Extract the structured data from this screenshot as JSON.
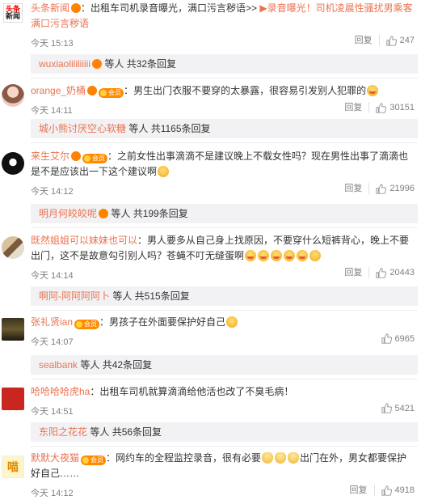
{
  "comments": [
    {
      "user": "头条新闻",
      "user_suffix": "：",
      "text": "出租车司机录音曝光，满口污言秽语>> ",
      "link": "录音曝光！司机凌晨性骚扰男乘客满口污言秽语",
      "time": "今天 15:13",
      "reply": "回复",
      "likes": "247"
    },
    {
      "user": "orange_奶桶",
      "user_suffix": "：",
      "text": "男生出门衣服不要穿的太暴露，很容易引发别人犯罪的",
      "time": "今天 14:11",
      "reply": "回复",
      "likes": "30151"
    },
    {
      "user": "来生艾尔",
      "user_suffix": "：",
      "text": "之前女性出事滴滴不是建议晚上不载女性吗？现在男性出事了滴滴也是不是应该出一下这个建议啊",
      "time": "今天 14:12",
      "reply": "回复",
      "likes": "21996"
    },
    {
      "user": "既然姐姐可以妹妹也可以",
      "user_suffix": "：",
      "text": "男人要多从自己身上找原因，不要穿什么短裤背心，晚上不要出门，这不是故意勾引别人吗？苍蝇不叮无缝蛋啊",
      "time": "今天 14:14",
      "reply": "回复",
      "likes": "20443"
    },
    {
      "user": "张礼贤ian",
      "user_suffix": "：",
      "text": "男孩子在外面要保护好自己",
      "time": "今天 14:07",
      "reply": "回复",
      "likes": "6965"
    },
    {
      "user": "哈哈哈哈虎ha",
      "user_suffix": "：",
      "text": "出租车司机就算滴滴给他活也改了不臭毛病！",
      "time": "今天 14:51",
      "reply": "回复",
      "likes": "5421"
    },
    {
      "user": "默默大夜猫",
      "user_suffix": "：",
      "text": "网约车的全程监控录音，很有必要",
      "text2": "出门在外，男女都要保护好自己……",
      "time": "今天 14:12",
      "reply": "回复",
      "likes": "4918"
    }
  ],
  "subreplies": [
    {
      "who": "wuxiaolililiiiii",
      "mid": " 等人 ",
      "count": "共32条回复"
    },
    {
      "who": "城小熊讨厌空心软糖",
      "mid": " 等人 ",
      "count": "共1165条回复"
    },
    {
      "who": "明月何皎皎呢",
      "mid": " 等人 ",
      "count": "共199条回复"
    },
    {
      "who": "啊阿-阿阿阿阿卜",
      "mid": " 等人 ",
      "count": "共515条回复"
    },
    {
      "who": "sealbank",
      "mid": " 等人 ",
      "count": "共42条回复"
    },
    {
      "who": "东阳之花花",
      "mid": " 等人 ",
      "count": "共56条回复"
    }
  ],
  "avatars": {
    "news_logo_line1": "头条",
    "news_logo_line2": "新闻",
    "cat_label": "喵"
  },
  "badges": {
    "vip_label": "会员"
  },
  "colors": {
    "username": "#eb7350",
    "link": "#eb7350",
    "meta": "#808080",
    "subbar_bg": "#f2f2f5"
  }
}
